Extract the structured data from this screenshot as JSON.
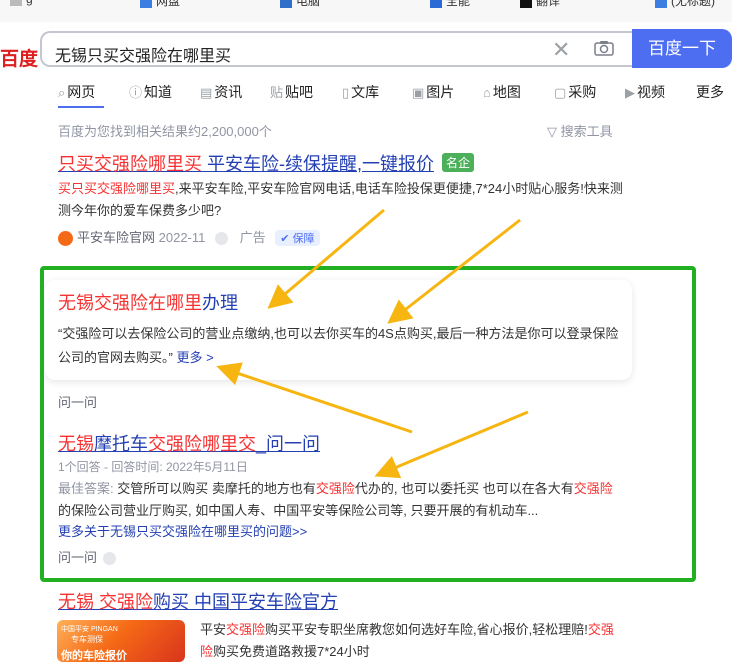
{
  "bookmarks": [
    {
      "label": "g",
      "icon": "bookmark-icon"
    },
    {
      "label": "网盘",
      "icon": "bookmark-icon"
    },
    {
      "label": "电脑",
      "icon": "bookmark-icon"
    },
    {
      "label": "全能",
      "icon": "bookmark-icon"
    },
    {
      "label": "翻译",
      "icon": "bookmark-icon"
    },
    {
      "label": "(无标题)",
      "icon": "bookmark-icon"
    }
  ],
  "header": {
    "logo": "百度",
    "query": "无锡只买交强险在哪里买",
    "search_button": "百度一下"
  },
  "tabs": [
    {
      "label": "网页",
      "icon": "search-icon"
    },
    {
      "label": "知道",
      "icon": "question-icon"
    },
    {
      "label": "资讯",
      "icon": "news-icon"
    },
    {
      "label": "贴吧",
      "icon": "tieba-icon"
    },
    {
      "label": "文库",
      "icon": "doc-icon"
    },
    {
      "label": "图片",
      "icon": "image-icon"
    },
    {
      "label": "地图",
      "icon": "map-icon"
    },
    {
      "label": "采购",
      "icon": "purchase-icon"
    },
    {
      "label": "视频",
      "icon": "video-icon"
    },
    {
      "label": "更多",
      "icon": ""
    }
  ],
  "result_count": "百度为您找到相关结果约2,200,000个",
  "search_tools": "搜索工具",
  "ad_result": {
    "title_red": "只买交强险哪里买",
    "title_rest": " 平安车险-续保提醒,一键报价",
    "badge": "名企",
    "abstract_red": "买只买交强险哪里买",
    "abstract_rest": ",来平安车险,平安车险官网电话,电话车险投保更便捷,7*24小时贴心服务!快来测测今年你的爱车保费多少吧?",
    "source": "平安车险官网",
    "date": "2022-11",
    "ad_label": "广告",
    "guarantee": "保障"
  },
  "answer_card": {
    "title_red": "无锡交强险在哪里",
    "title_rest": "办理",
    "text": "“交强险可以去保险公司的营业点缴纳,也可以去你买车的4S点购买,最后一种方法是你可以登录保险公司的官网去购买。”",
    "more": "更多 >",
    "ask": "问一问"
  },
  "zhidao_result": {
    "title_p1": "无锡",
    "title_p2": "摩托车",
    "title_p3": "交强险哪里交",
    "title_p4": "_问一问",
    "meta": "1个回答 - 回答时间: 2022年5月11日",
    "best_label": "最佳答案:",
    "answer_a": " 交管所可以购买 卖摩托的地方也有",
    "answer_red1": "交强险",
    "answer_b": "代办的, 也可以委托买 也可以在各大有",
    "answer_red2": "交强险",
    "answer_c": "的保险公司营业厅购买, 如中国人寿、中国平安等保险公司等, 只要开展的有机动车...",
    "more_link": "更多关于无锡只买交强险在哪里买的问题>>",
    "ask": "问一问"
  },
  "last_result": {
    "title_red": "无锡 交强险",
    "title_rest": "购买 中国平安车险官方",
    "snip_a": "平安",
    "snip_red1": "交强险",
    "snip_b": "购买平安专职坐席教您如何选好车险,省心报价,轻松理赔!",
    "snip_red2": "交强险",
    "snip_c": "购买免费道路救援7*24小时",
    "thumb_brand": "中国平安 PINGAN",
    "thumb_line": "专车测保",
    "thumb_main": "你的车险报价"
  },
  "colors": {
    "brand_blue": "#4e6ef2",
    "link_blue": "#2440b3",
    "highlight_red": "#f73131",
    "annotation_green": "#22b022",
    "arrow_orange": "#f7b512"
  }
}
